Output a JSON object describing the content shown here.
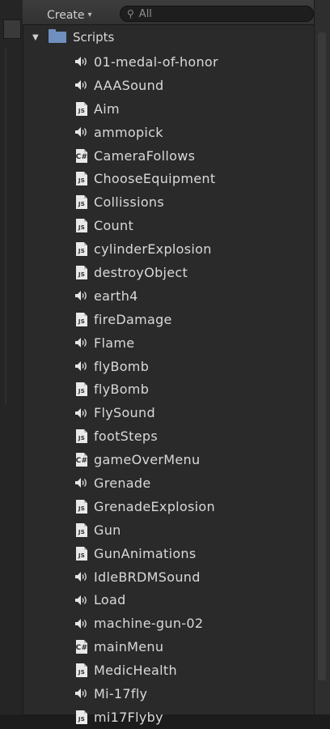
{
  "toolbar": {
    "create_label": "Create",
    "create_caret": "▾",
    "search_placeholder": "All",
    "search_icon": "search-icon"
  },
  "tree": {
    "folder": {
      "label": "Scripts",
      "expanded": true,
      "icon": "folder-icon"
    },
    "items": [
      {
        "label": "01-medal-of-honor",
        "type": "audio"
      },
      {
        "label": "AAASound",
        "type": "audio"
      },
      {
        "label": "Aim",
        "type": "js"
      },
      {
        "label": "ammopick",
        "type": "audio"
      },
      {
        "label": "CameraFollows",
        "type": "cs"
      },
      {
        "label": "ChooseEquipment",
        "type": "js"
      },
      {
        "label": "Collissions",
        "type": "js"
      },
      {
        "label": "Count",
        "type": "js"
      },
      {
        "label": "cylinderExplosion",
        "type": "js"
      },
      {
        "label": "destroyObject",
        "type": "js"
      },
      {
        "label": "earth4",
        "type": "audio"
      },
      {
        "label": "fireDamage",
        "type": "js"
      },
      {
        "label": "Flame",
        "type": "audio"
      },
      {
        "label": "flyBomb",
        "type": "audio"
      },
      {
        "label": "flyBomb",
        "type": "js"
      },
      {
        "label": "FlySound",
        "type": "audio"
      },
      {
        "label": "footSteps",
        "type": "js"
      },
      {
        "label": "gameOverMenu",
        "type": "cs"
      },
      {
        "label": "Grenade",
        "type": "audio"
      },
      {
        "label": "GrenadeExplosion",
        "type": "js"
      },
      {
        "label": "Gun",
        "type": "js"
      },
      {
        "label": "GunAnimations",
        "type": "js"
      },
      {
        "label": "IdleBRDMSound",
        "type": "audio"
      },
      {
        "label": "Load",
        "type": "audio"
      },
      {
        "label": "machine-gun-02",
        "type": "audio"
      },
      {
        "label": "mainMenu",
        "type": "cs"
      },
      {
        "label": "MedicHealth",
        "type": "js"
      },
      {
        "label": "Mi-17fly",
        "type": "audio"
      },
      {
        "label": "mi17Flyby",
        "type": "js"
      }
    ]
  },
  "colors": {
    "background": "#2a2a2a",
    "text": "#d9d9d9",
    "folder": "#6f8fbf"
  }
}
